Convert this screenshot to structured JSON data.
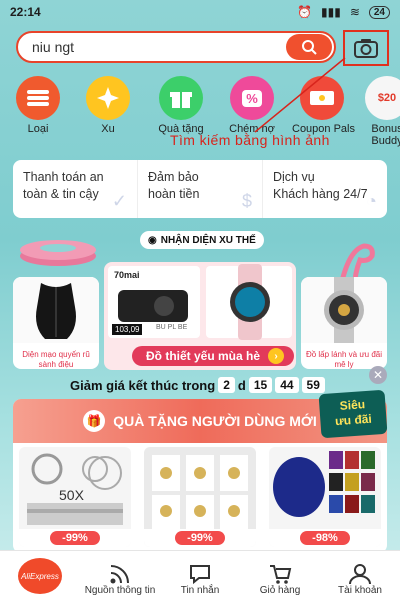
{
  "status": {
    "time": "22:14",
    "battery": "24"
  },
  "search": {
    "query": "niu ngt"
  },
  "categories": [
    {
      "label": "Loại",
      "color": "#f05a2e"
    },
    {
      "label": "Xu",
      "color": "#ffc520"
    },
    {
      "label": "Quà tặng",
      "color": "#3ccf6a"
    },
    {
      "label": "Chém nợ",
      "color": "#ef4a9a"
    },
    {
      "label": "Coupon Pals",
      "color": "#f04a3a"
    },
    {
      "label": "Bonus Buddy",
      "color": "#f6f6f6"
    }
  ],
  "cat_badges": {
    "chemno": "%",
    "bonus": "$20"
  },
  "annotation": "Tìm kiếm bằng hình ảnh",
  "info": [
    {
      "l1": "Thanh toán an",
      "l2": "toàn & tin cậy"
    },
    {
      "l1": "Đảm bảo",
      "l2": "hoàn tiền"
    },
    {
      "l1": "Dịch vụ",
      "l2": "Khách hàng 24/7"
    }
  ],
  "trend_label": "NHẬN DIỆN XU THẾ",
  "promo": {
    "left_caption": "Diện mạo quyến rũ sành điệu",
    "center_caption": "Đồ thiết yếu mùa hè",
    "right_caption": "Đồ lấp lánh và ưu đãi mê ly",
    "brand": "70mai",
    "price": "103,09",
    "tag": "BU PL BE"
  },
  "countdown": {
    "label": "Giảm giá kết thúc trong",
    "days": "2",
    "d": "d",
    "h": "15",
    "m": "44",
    "s": "59"
  },
  "gift": {
    "title": "QUÀ TẶNG NGƯỜI DÙNG MỚI",
    "badge_l1": "Siêu",
    "badge_l2": "ưu đãi",
    "items": [
      {
        "discount": "-99%",
        "label": "50X"
      },
      {
        "discount": "-99%"
      },
      {
        "discount": "-98%"
      }
    ]
  },
  "nav": [
    {
      "label": "AliExpress"
    },
    {
      "label": "Nguồn thông tin"
    },
    {
      "label": "Tin nhắn"
    },
    {
      "label": "Giỏ hàng"
    },
    {
      "label": "Tài khoản"
    }
  ]
}
